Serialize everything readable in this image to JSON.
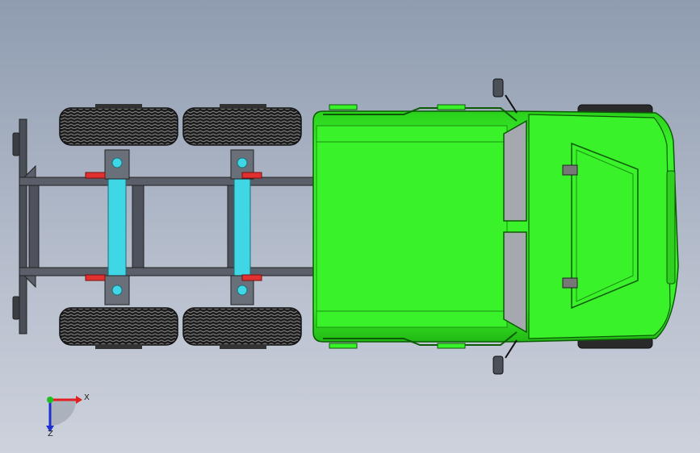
{
  "viewport": {
    "view_orientation": "top",
    "background_top": "#8f9cb0",
    "background_bottom": "#cdd2dc"
  },
  "model": {
    "cab_color": "#33ee22",
    "cab_dark": "#17a80f",
    "frame_color": "#505560",
    "axle_color": "#3fd6e6",
    "bracket_red": "#e03030",
    "tire_color": "#1c1c1c",
    "window_color": "#a6a8b0"
  },
  "triad": {
    "x_label": "X",
    "z_label": "Z",
    "x_color": "#e02020",
    "z_color": "#2030d0",
    "y_color": "#20c020"
  }
}
